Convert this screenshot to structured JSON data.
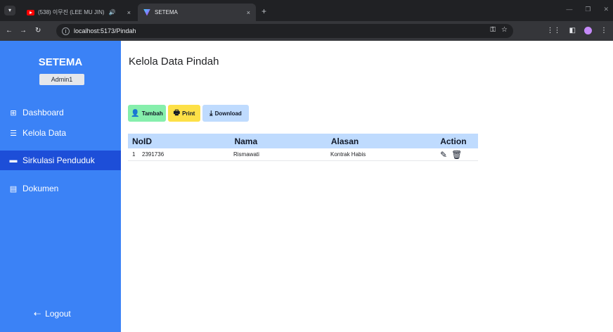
{
  "browser": {
    "tabs": [
      {
        "title": "(538) 이무진 (LEE MU JIN)",
        "speaker": "🔊",
        "close": "×"
      },
      {
        "title": "SETEMA",
        "close": "×"
      }
    ],
    "new_tab": "+",
    "url": "localhost:5173/Pindah"
  },
  "sidebar": {
    "brand": "SETEMA",
    "user": "Admin1",
    "items": [
      {
        "label": "Dashboard",
        "icon": "dashboard-icon"
      },
      {
        "label": "Kelola Data",
        "icon": "database-icon"
      },
      {
        "label": "Sirkulasi Penduduk",
        "icon": "card-icon"
      },
      {
        "label": "Dokumen",
        "icon": "document-icon"
      }
    ],
    "logout": "Logout"
  },
  "main": {
    "title": "Kelola Data Pindah",
    "buttons": {
      "tambah": "Tambah",
      "print": "Print",
      "download": "Download"
    },
    "table": {
      "headers": [
        "No.",
        "ID",
        "Nama",
        "Alasan",
        "Action"
      ],
      "rows": [
        {
          "no": "1",
          "id": "2391736",
          "nama": "Rismawati",
          "alasan": "Kontrak Habis"
        }
      ]
    }
  },
  "colors": {
    "sidebar": "#3b82f6",
    "sidebar_active": "#1d4ed8",
    "btn_tambah": "#86efac",
    "btn_print": "#fde047",
    "btn_download": "#bfdbfe",
    "table_header": "#bfdbfe"
  }
}
